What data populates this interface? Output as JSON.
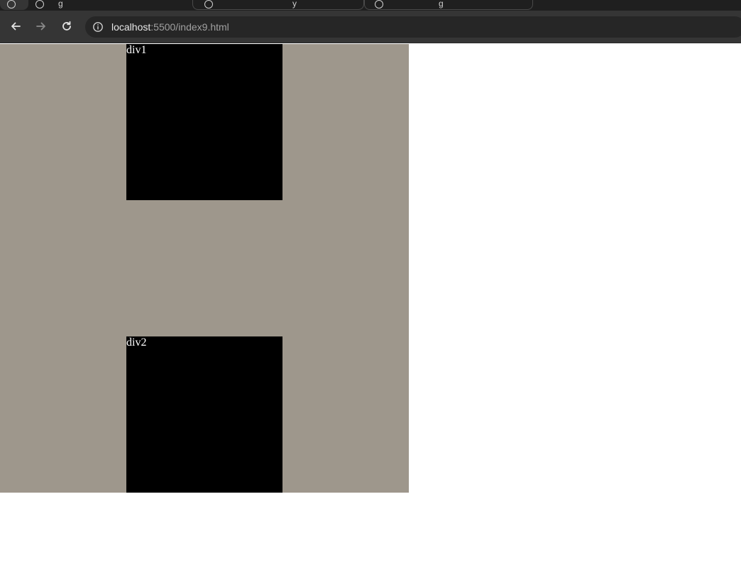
{
  "browser": {
    "tabs": [
      {
        "label": "g"
      },
      {
        "label": "y"
      },
      {
        "label": "g"
      }
    ],
    "address_bar": {
      "host": "localhost",
      "rest": ":5500/index9.html"
    },
    "icons": {
      "back": "arrow-left-icon",
      "forward": "arrow-right-icon",
      "reload": "reload-icon",
      "site_info": "info-icon"
    }
  },
  "page": {
    "colors": {
      "container_bg": "#9e978c",
      "box_bg": "#000000",
      "box_text": "#ffffff"
    },
    "div1": {
      "label": "div1"
    },
    "div2": {
      "label": "div2"
    }
  }
}
